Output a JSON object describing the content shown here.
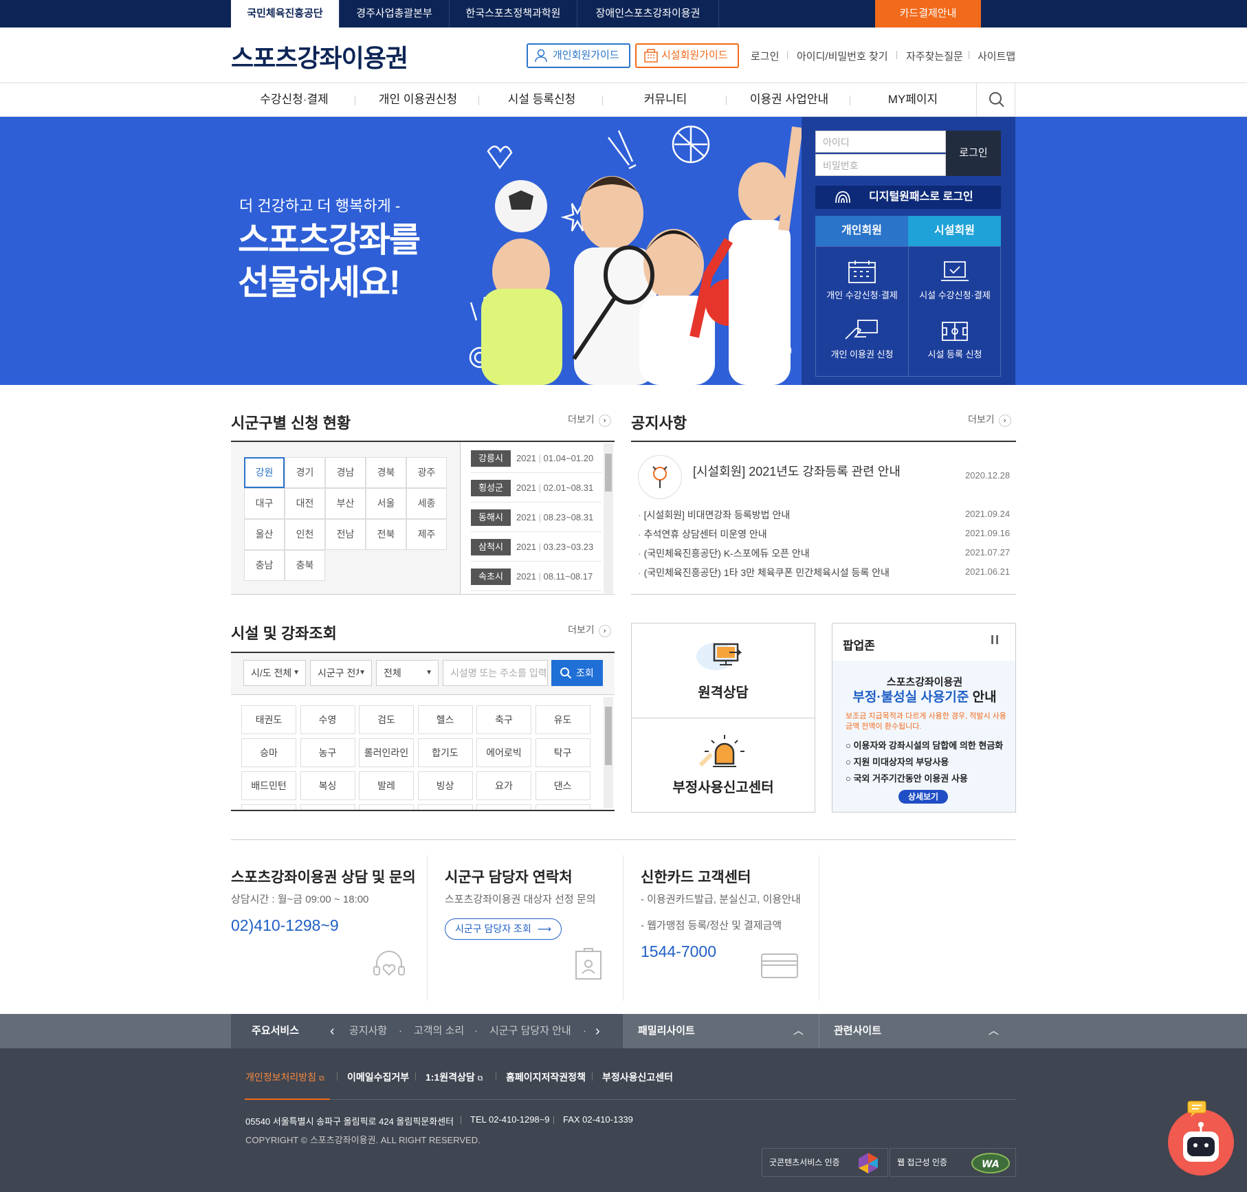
{
  "topbar": {
    "tabs": [
      "국민체육진흥공단",
      "경주사업총괄본부",
      "한국스포츠정책과학원",
      "장애인스포츠강좌이용권"
    ],
    "card_button": "카드결제안내"
  },
  "header": {
    "logo": "스포츠강좌이용권",
    "personal_guide": "개인회원가이드",
    "facility_guide": "시설회원가이드",
    "links": [
      "로그인",
      "아이디/비밀번호 찾기",
      "자주찾는질문",
      "사이트맵"
    ]
  },
  "nav": {
    "items": [
      "수강신청·결제",
      "개인 이용권신청",
      "시설 등록신청",
      "커뮤니티",
      "이용권 사업안내",
      "MY페이지"
    ]
  },
  "hero": {
    "subtitle": "더 건강하고 더 행복하게 -",
    "title_line1": "스포츠강좌를",
    "title_line2": "선물하세요!"
  },
  "login": {
    "id_placeholder": "아이디",
    "pw_placeholder": "비밀번호",
    "login_button": "로그인",
    "digital_pass": "디지털원패스로 로그인",
    "tab_personal": "개인회원",
    "tab_facility": "시설회원",
    "quick": [
      "개인 수강신청·결제",
      "시설 수강신청·결제",
      "개인 이용권 신청",
      "시설 등록 신청"
    ]
  },
  "region": {
    "title": "시군구별 신청 현황",
    "more": "더보기",
    "cells": [
      "강원",
      "경기",
      "경남",
      "경북",
      "광주",
      "대구",
      "대전",
      "부산",
      "서울",
      "세종",
      "울산",
      "인천",
      "전남",
      "전북",
      "제주",
      "충남",
      "충북"
    ],
    "list": [
      {
        "name": "강릉시",
        "year": "2021",
        "period": "01.04~01.20"
      },
      {
        "name": "횡성군",
        "year": "2021",
        "period": "02.01~08.31"
      },
      {
        "name": "동해시",
        "year": "2021",
        "period": "08.23~08.31"
      },
      {
        "name": "삼척시",
        "year": "2021",
        "period": "03.23~03.23"
      },
      {
        "name": "속초시",
        "year": "2021",
        "period": "08.11~08.17"
      }
    ]
  },
  "notice": {
    "title": "공지사항",
    "more": "더보기",
    "featured": {
      "title": "[시설회원] 2021년도 강좌등록 관련 안내",
      "date": "2020.12.28"
    },
    "items": [
      {
        "title": "[시설회원] 비대면강좌 등록방법 안내",
        "date": "2021.09.24"
      },
      {
        "title": "추석연휴 상담센터 미운영 안내",
        "date": "2021.09.16"
      },
      {
        "title": "(국민체육진흥공단) K-스포에듀 오픈 안내",
        "date": "2021.07.27"
      },
      {
        "title": "(국민체육진흥공단) 1타 3만 체육쿠폰 민간체육시설 등록 안내",
        "date": "2021.06.21"
      }
    ]
  },
  "search": {
    "title": "시설 및 강좌조회",
    "more": "더보기",
    "sido": "시/도 전체",
    "sigungu": "시군구 전체",
    "type": "전체",
    "placeholder": "시설명 또는 주소를 입력",
    "button": "조회",
    "sports": [
      "태권도",
      "수영",
      "검도",
      "헬스",
      "축구",
      "유도",
      "승마",
      "농구",
      "롤러인라인",
      "합기도",
      "에어로빅",
      "탁구",
      "배드민턴",
      "복싱",
      "발레",
      "빙상",
      "요가",
      "댄스"
    ]
  },
  "side_boxes": {
    "remote": "원격상담",
    "report": "부정사용신고센터"
  },
  "popup": {
    "title": "팝업존",
    "line1": "스포츠강좌이용권",
    "line2_blue": "부정·불성실 사용기준",
    "line2_black": " 안내",
    "warning": "보조금 지급목적과 다르게 사용한 경우, 적발시 사용금액 전액이 환수됩니다.",
    "bullets": [
      "이용자와 강좌시설의 담합에 의한 현금화",
      "지원 미대상자의 부당사용",
      "국외 거주기간동안 이용권 사용"
    ],
    "button": "상세보기"
  },
  "contact": {
    "c1_title": "스포츠강좌이용권 상담 및 문의",
    "c1_text": "상담시간 : 월~금 09:00 ~ 18:00",
    "c1_number": "02)410-1298~9",
    "c2_title": "시군구 담당자 연락처",
    "c2_text": "스포츠강좌이용권 대상자 선정 문의",
    "c2_button": "시군구 담당자 조회",
    "c3_title": "신한카드 고객센터",
    "c3_text1": "- 이용권카드발급, 분실신고, 이용안내",
    "c3_text2": "- 웹가맹점 등록/정산 및 결제금액",
    "c3_number": "1544-7000"
  },
  "footer": {
    "main_service": "주요서비스",
    "service_links": [
      "공지사항",
      "고객의 소리",
      "시군구 담당자 안내"
    ],
    "family": "패밀리사이트",
    "related": "관련사이트",
    "links": [
      "개인정보처리방침",
      "이메일수집거부",
      "1:1원격상담",
      "홈페이지저작권정책",
      "부정사용신고센터"
    ],
    "address": "05540 서울특별시 송파구 올림픽로 424 올림픽문화센터",
    "tel": "TEL 02-410-1298~9",
    "fax": "FAX 02-410-1339",
    "copyright": "COPYRIGHT © 스포츠강좌이용권. ALL RIGHT RESERVED.",
    "cert1": "굿콘텐츠서비스 인증",
    "cert2": "웹 접근성 인증"
  },
  "colors": {
    "navy": "#0d2556",
    "orange": "#f26a1b",
    "hero_blue": "#2e5fd6",
    "accent_blue": "#1f5fc5"
  }
}
